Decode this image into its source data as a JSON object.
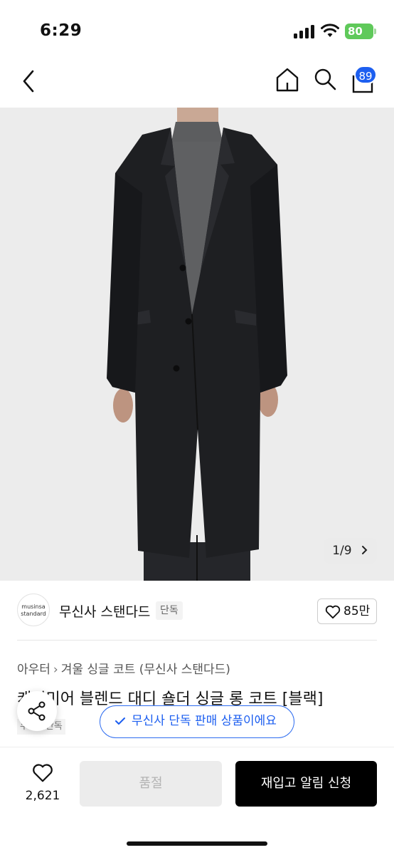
{
  "status_bar": {
    "time": "6:29",
    "battery": "80"
  },
  "nav": {
    "cart_count": "89"
  },
  "gallery": {
    "page_indicator": "1/9"
  },
  "brand": {
    "logo_line1": "musinsa",
    "logo_line2": "standard",
    "name": "무신사 스탠다드",
    "tag": "단독",
    "like_count": "85만"
  },
  "breadcrumb": {
    "level1": "아우터",
    "level2": "겨울 싱글 코트 (무신사 스탠다드)"
  },
  "product": {
    "title": "캐시미어 블렌드 대디 숄더 싱글 롱 코트 [블랙]",
    "exclusive_tag": "무신사단독",
    "exclusive_notice": "무신사 단독 판매 상품이에요"
  },
  "bottom_bar": {
    "wish_count": "2,621",
    "soldout_label": "품절",
    "restock_label": "재입고 알림 신청"
  },
  "colors": {
    "accent": "#1d5ff0",
    "battery": "#5fc95a",
    "coat": "#1e1f22",
    "sweater": "#5c5d5f"
  },
  "icons": [
    "wifi-icon",
    "back-icon",
    "home-icon",
    "search-icon",
    "cart-icon",
    "heart-icon",
    "share-icon",
    "check-icon",
    "chevron-right-icon"
  ]
}
